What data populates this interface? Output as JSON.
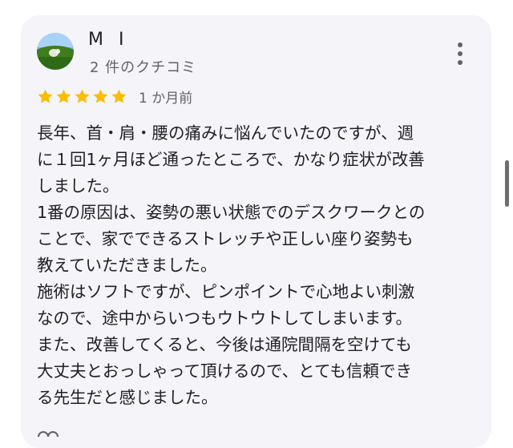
{
  "review": {
    "user_name": "M I",
    "review_count": "2 件のクチコミ",
    "rating": 5,
    "rating_max": 5,
    "star_color": "#fbbc04",
    "date": "1 か月前",
    "text_lines": [
      "長年、首・肩・腰の痛みに悩んでいたのですが、週",
      "に１回1ヶ月ほど通ったところで、かなり症状が改善",
      "しました。",
      "1番の原因は、姿勢の悪い状態でのデスクワークとの",
      "ことで、家でできるストレッチや正しい座り姿勢も",
      "教えていただきました。",
      "施術はソフトですが、ピンポイントで心地よい刺激",
      "なので、途中からいつもウトウトしてしまいます。",
      "また、改善してくると、今後は通院間隔を空けても",
      "大丈夫とおっしゃって頂けるので、とても信頼でき",
      "る先生だと感じました。"
    ]
  },
  "icons": {
    "menu": "more-vert-icon",
    "star": "star-icon",
    "avatar": "user-avatar"
  },
  "colors": {
    "card_background": "#f5f4f9",
    "text_primary": "#202124",
    "text_secondary": "#5f6368"
  }
}
